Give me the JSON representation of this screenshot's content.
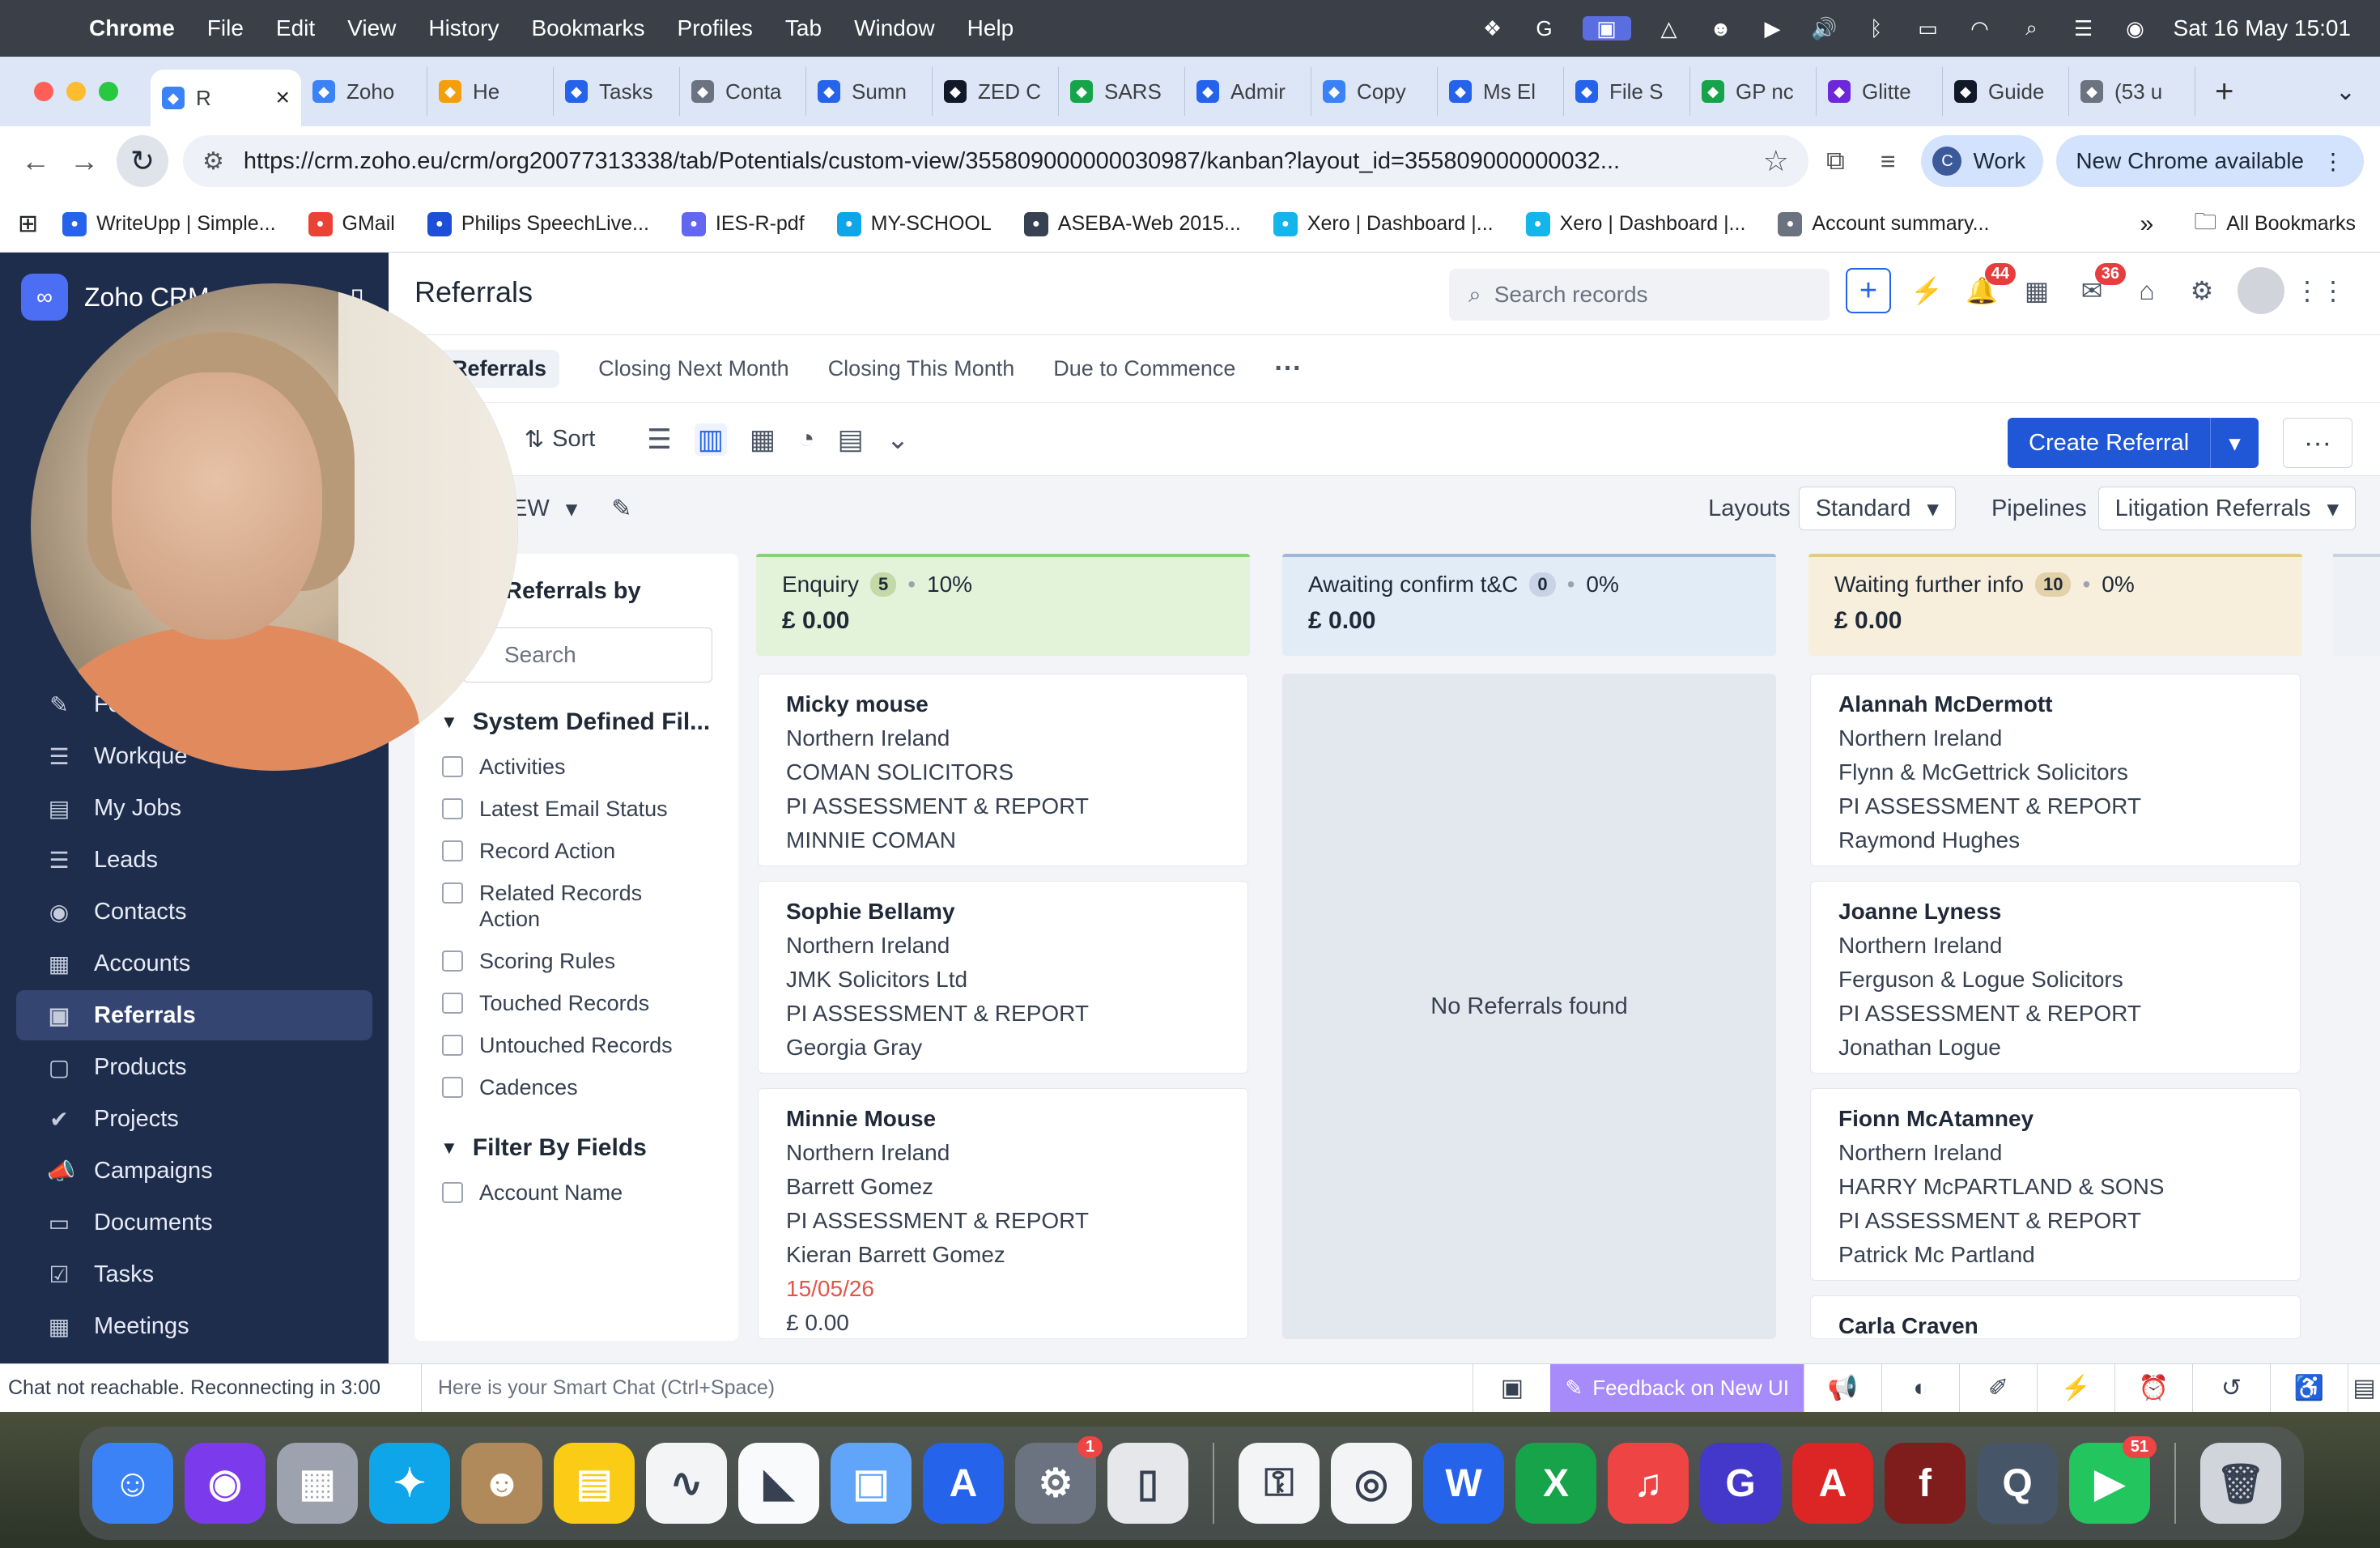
{
  "menubar": {
    "app": "Chrome",
    "items": [
      "File",
      "Edit",
      "View",
      "History",
      "Bookmarks",
      "Profiles",
      "Tab",
      "Window",
      "Help"
    ],
    "clock": "Sat 16 May  15:01"
  },
  "tabs": [
    {
      "title": "R",
      "color": "#3b82f6",
      "active": true
    },
    {
      "title": "Zoho",
      "color": "#3b82f6"
    },
    {
      "title": "He",
      "color": "#f59e0b"
    },
    {
      "title": "Tasks",
      "color": "#2563eb"
    },
    {
      "title": "Conta",
      "color": "#6b7280"
    },
    {
      "title": "Sumn",
      "color": "#2563eb"
    },
    {
      "title": "ZED C",
      "color": "#111827"
    },
    {
      "title": "SARS",
      "color": "#16a34a"
    },
    {
      "title": "Admir",
      "color": "#2563eb"
    },
    {
      "title": "Copy",
      "color": "#3b82f6"
    },
    {
      "title": "Ms El",
      "color": "#2563eb"
    },
    {
      "title": "File S",
      "color": "#2563eb"
    },
    {
      "title": "GP nc",
      "color": "#16a34a"
    },
    {
      "title": "Glitte",
      "color": "#6d28d9"
    },
    {
      "title": "Guide",
      "color": "#111827"
    },
    {
      "title": "(53 u",
      "color": "#6b7280"
    }
  ],
  "address": {
    "url": "https://crm.zoho.eu/crm/org20077313338/tab/Potentials/custom-view/355809000000030987/kanban?layout_id=355809000000032...",
    "profile": "Work",
    "profile_initial": "C",
    "update": "New Chrome available"
  },
  "bookmarks": [
    {
      "label": "WriteUpp | Simple...",
      "color": "#2563eb"
    },
    {
      "label": "GMail",
      "color": "#ea4335"
    },
    {
      "label": "Philips SpeechLive...",
      "color": "#1d4ed8"
    },
    {
      "label": "IES-R-pdf",
      "color": "#6366f1"
    },
    {
      "label": "MY-SCHOOL",
      "color": "#0ea5e9"
    },
    {
      "label": "ASEBA-Web 2015...",
      "color": "#374151"
    },
    {
      "label": "Xero | Dashboard |...",
      "color": "#13b5ea"
    },
    {
      "label": "Xero | Dashboard |...",
      "color": "#13b5ea"
    },
    {
      "label": "Account summary...",
      "color": "#6b7280"
    }
  ],
  "bookmarks_all": "All Bookmarks",
  "crm": {
    "brand": "Zoho CRM",
    "sidebar": [
      {
        "label": "Fo",
        "icon": "✎"
      },
      {
        "label": "Workque",
        "icon": "☰"
      },
      {
        "label": "My Jobs",
        "icon": "▤"
      },
      {
        "label": "Leads",
        "icon": "☰"
      },
      {
        "label": "Contacts",
        "icon": "◉"
      },
      {
        "label": "Accounts",
        "icon": "▦"
      },
      {
        "label": "Referrals",
        "icon": "▣",
        "active": true
      },
      {
        "label": "Products",
        "icon": "▢"
      },
      {
        "label": "Projects",
        "icon": "✔"
      },
      {
        "label": "Campaigns",
        "icon": "📣"
      },
      {
        "label": "Documents",
        "icon": "▭"
      },
      {
        "label": "Tasks",
        "icon": "☑"
      },
      {
        "label": "Meetings",
        "icon": "▦"
      }
    ],
    "page_title": "Referrals",
    "search_placeholder": "Search records",
    "badges": {
      "notifications": "44",
      "mail": "36"
    },
    "views": [
      "Referrals",
      "Closing Next Month",
      "Closing This Month",
      "Due to Commence"
    ],
    "actions": {
      "filter": "er",
      "sort": "Sort",
      "create": "Create Referral"
    },
    "layoutbar": {
      "view_name": "EW",
      "layouts_label": "Layouts",
      "layout": "Standard",
      "pipelines_label": "Pipelines",
      "pipeline": "Litigation Referrals"
    },
    "filter": {
      "title": "Referrals by",
      "search": "Search",
      "section1": "System Defined Fil...",
      "items": [
        "Activities",
        "Latest Email Status",
        "Record Action",
        "Related Records Action",
        "Scoring Rules",
        "Touched Records",
        "Untouched Records",
        "Cadences"
      ],
      "section2": "Filter By Fields",
      "items2": [
        "Account Name"
      ]
    },
    "columns": [
      {
        "name": "Enquiry",
        "count": "5",
        "pct": "10%",
        "amount": "£ 0.00",
        "cards": [
          {
            "lines": [
              "Micky mouse",
              "Northern Ireland",
              "COMAN SOLICITORS",
              "PI ASSESSMENT & REPORT",
              "MINNIE COMAN"
            ]
          },
          {
            "lines": [
              "Sophie Bellamy",
              "Northern Ireland",
              "JMK Solicitors Ltd",
              "PI ASSESSMENT & REPORT",
              "Georgia Gray"
            ]
          },
          {
            "lines": [
              "Minnie Mouse",
              "Northern Ireland",
              "Barrett Gomez",
              "PI ASSESSMENT & REPORT",
              "Kieran Barrett Gomez"
            ],
            "date": "15/05/26",
            "amount": "£ 0.00"
          }
        ]
      },
      {
        "name": "Awaiting confirm t&C",
        "count": "0",
        "pct": "0%",
        "amount": "£ 0.00",
        "empty": "No Referrals found"
      },
      {
        "name": "Waiting further info",
        "count": "10",
        "pct": "0%",
        "amount": "£ 0.00",
        "cards": [
          {
            "lines": [
              "Alannah McDermott",
              "Northern Ireland",
              "Flynn & McGettrick Solicitors",
              "PI ASSESSMENT & REPORT",
              "Raymond Hughes"
            ]
          },
          {
            "lines": [
              "Joanne Lyness",
              "Northern Ireland",
              "Ferguson & Logue Solicitors",
              "PI ASSESSMENT & REPORT",
              "Jonathan Logue"
            ]
          },
          {
            "lines": [
              "Fionn McAtamney",
              "Northern Ireland",
              "HARRY McPARTLAND & SONS",
              "PI ASSESSMENT & REPORT",
              "Patrick Mc Partland"
            ]
          },
          {
            "lines": [
              "Carla Craven"
            ]
          }
        ]
      }
    ],
    "bottom": {
      "status": "Chat not reachable. Reconnecting in 3:00",
      "chat_placeholder": "Here is your Smart Chat (Ctrl+Space)",
      "feedback": "Feedback on New UI"
    }
  },
  "dock": [
    {
      "name": "Finder",
      "color": "#3b82f6",
      "glyph": "☺"
    },
    {
      "name": "Siri",
      "color": "#7c3aed",
      "glyph": "◉"
    },
    {
      "name": "Launchpad",
      "color": "#9ca3af",
      "glyph": "▦"
    },
    {
      "name": "Safari",
      "color": "#0ea5e9",
      "glyph": "✦"
    },
    {
      "name": "Contacts",
      "color": "#b08a5a",
      "glyph": "☻"
    },
    {
      "name": "Notes",
      "color": "#facc15",
      "glyph": "▤"
    },
    {
      "name": "Freeform",
      "color": "#f3f4f6",
      "glyph": "∿"
    },
    {
      "name": "Vectorworks",
      "color": "#f9fafb",
      "glyph": "◣"
    },
    {
      "name": "Preview",
      "color": "#60a5fa",
      "glyph": "▣"
    },
    {
      "name": "App Store",
      "color": "#2563eb",
      "glyph": "A"
    },
    {
      "name": "System Settings",
      "color": "#6b7280",
      "glyph": "⚙",
      "badge": "1"
    },
    {
      "name": "iPhone Mirroring",
      "color": "#e5e7eb",
      "glyph": "▯"
    },
    {
      "name": "Passwords",
      "color": "#f3f4f6",
      "glyph": "⚿"
    },
    {
      "name": "Chrome",
      "color": "#f3f4f6",
      "glyph": "◎"
    },
    {
      "name": "Word",
      "color": "#2563eb",
      "glyph": "W"
    },
    {
      "name": "Excel",
      "color": "#16a34a",
      "glyph": "X"
    },
    {
      "name": "Music",
      "color": "#ef4444",
      "glyph": "♫"
    },
    {
      "name": "Grammarly",
      "color": "#4338ca",
      "glyph": "G"
    },
    {
      "name": "Acrobat",
      "color": "#dc2626",
      "glyph": "A"
    },
    {
      "name": "Flash",
      "color": "#7f1d1d",
      "glyph": "f"
    },
    {
      "name": "QuickTime",
      "color": "#475569",
      "glyph": "Q"
    },
    {
      "name": "FaceTime",
      "color": "#22c55e",
      "glyph": "▶",
      "badge": "51"
    },
    {
      "name": "Trash",
      "color": "#d1d5db",
      "glyph": "🗑"
    }
  ]
}
